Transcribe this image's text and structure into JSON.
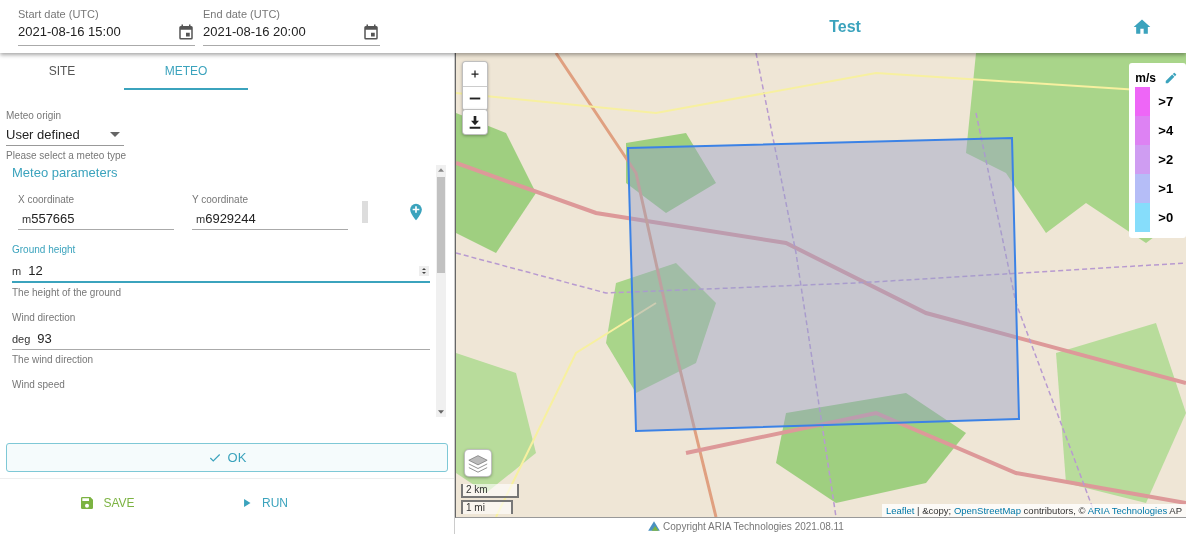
{
  "header": {
    "start_date": {
      "label": "Start date (UTC)",
      "value": "2021-08-16 15:00"
    },
    "end_date": {
      "label": "End date (UTC)",
      "value": "2021-08-16 20:00"
    },
    "title": "Test"
  },
  "tabs": [
    {
      "label": "SITE",
      "selected": false
    },
    {
      "label": "METEO",
      "selected": true
    }
  ],
  "meteo_origin": {
    "label": "Meteo origin",
    "value": "User defined",
    "hint": "Please select a meteo type"
  },
  "section_title": "Meteo parameters",
  "coordinates": [
    {
      "label": "X coordinate",
      "unit": "m",
      "value": "557665"
    },
    {
      "label": "Y coordinate",
      "unit": "m",
      "value": "6929244"
    }
  ],
  "parameters": [
    {
      "label": "Ground height",
      "unit": "m",
      "value": "12",
      "hint": "The height of the ground",
      "focused": true
    },
    {
      "label": "Wind direction",
      "unit": "deg",
      "value": "93",
      "hint": "The wind direction",
      "focused": false
    },
    {
      "label": "Wind speed",
      "focused": false
    }
  ],
  "ok_button": "OK",
  "actions": [
    {
      "label": "SAVE",
      "kind": "save"
    },
    {
      "label": "RUN",
      "kind": "run"
    }
  ],
  "map": {
    "legend": {
      "unit": "m/s",
      "items": [
        {
          "label": ">7",
          "color": "#ee66f7"
        },
        {
          "label": ">4",
          "color": "#dd82f3"
        },
        {
          "label": ">2",
          "color": "#cf9df2"
        },
        {
          "label": ">1",
          "color": "#b5bdf7"
        },
        {
          "label": ">0",
          "color": "#86ddfb"
        }
      ]
    },
    "scale": [
      "2 km",
      "1 mi"
    ],
    "attribution": [
      {
        "text": "Leaflet",
        "kind": "link"
      },
      {
        "text": " | &copy; ",
        "kind": "text"
      },
      {
        "text": "OpenStreetMap",
        "kind": "link"
      },
      {
        "text": " contributors, © ",
        "kind": "text"
      },
      {
        "text": "ARIA Technologies",
        "kind": "link"
      },
      {
        "text": " AP",
        "kind": "text"
      }
    ]
  },
  "footer": "Copyright ARIA Technologies 2021.08.11"
}
